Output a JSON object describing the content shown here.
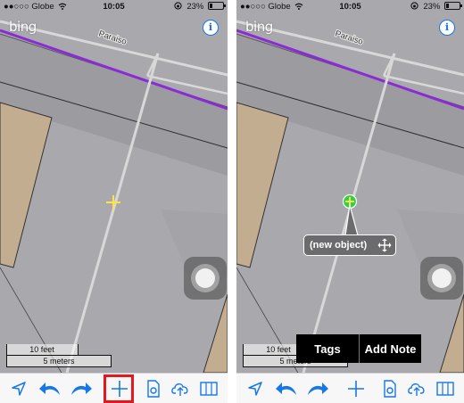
{
  "status_bar": {
    "carrier": "●●○○○ Globe",
    "time": "10:05",
    "battery": "23%",
    "battery_fraction": 0.23
  },
  "map": {
    "provider_logo": "bing",
    "street_label": "Paraiso",
    "info_icon": "info-icon",
    "scale_short": "10 feet",
    "scale_long": "5 meters"
  },
  "toolbar": {
    "items": [
      {
        "name": "location-arrow-icon"
      },
      {
        "name": "undo-icon"
      },
      {
        "name": "redo-icon"
      },
      {
        "name": "add-icon"
      },
      {
        "name": "settings-file-icon"
      },
      {
        "name": "upload-cloud-icon"
      },
      {
        "name": "map-layers-icon"
      }
    ],
    "highlight_color": "#e3171e"
  },
  "new_object": {
    "label": "(new object)",
    "move_icon": "move-arrows-icon",
    "node_color": "#2fd14b"
  },
  "context_menu": {
    "tags_label": "Tags",
    "note_label": "Add Note"
  },
  "colors": {
    "accent": "#1677e8",
    "road_purple": "#8a2bd6",
    "building_tan": "#c2ad90"
  }
}
